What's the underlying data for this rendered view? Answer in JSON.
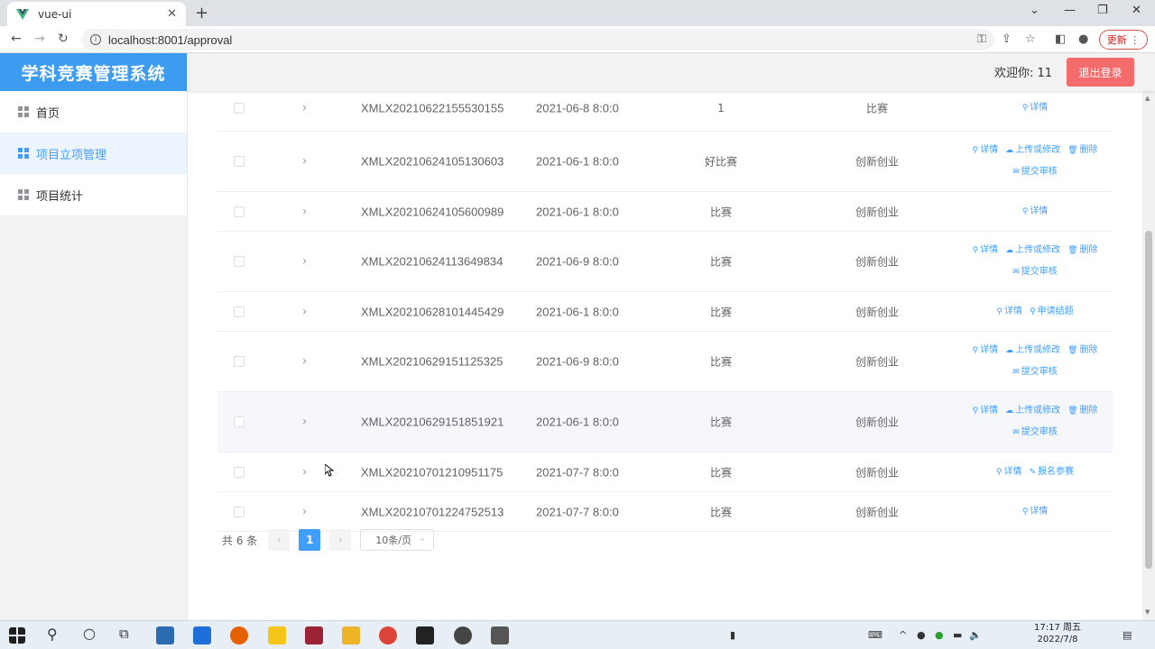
{
  "browser": {
    "tab_title": "vue-ui",
    "url": "localhost:8001/approval",
    "update_label": "更新"
  },
  "app": {
    "title": "学科竞赛管理系统",
    "welcome": "欢迎你: 11",
    "logout_label": "退出登录"
  },
  "sidebar": {
    "items": [
      {
        "label": "首页"
      },
      {
        "label": "项目立项管理"
      },
      {
        "label": "项目统计"
      }
    ]
  },
  "table": {
    "rows": [
      {
        "id": "XMLX20210622155530155",
        "date": "2021-06-8 8:0:0",
        "name": "1",
        "type": "比赛",
        "ops": [
          "详情"
        ]
      },
      {
        "id": "XMLX20210624105130603",
        "date": "2021-06-1 8:0:0",
        "name": "好比赛",
        "type": "创新创业",
        "ops": [
          "详情",
          "上传或修改",
          "删除",
          "提交审核"
        ]
      },
      {
        "id": "XMLX20210624105600989",
        "date": "2021-06-1 8:0:0",
        "name": "比赛",
        "type": "创新创业",
        "ops": [
          "详情"
        ]
      },
      {
        "id": "XMLX20210624113649834",
        "date": "2021-06-9 8:0:0",
        "name": "比赛",
        "type": "创新创业",
        "ops": [
          "详情",
          "上传或修改",
          "删除",
          "提交审核"
        ]
      },
      {
        "id": "XMLX20210628101445429",
        "date": "2021-06-1 8:0:0",
        "name": "比赛",
        "type": "创新创业",
        "ops": [
          "详情",
          "申请结题"
        ]
      },
      {
        "id": "XMLX20210629151125325",
        "date": "2021-06-9 8:0:0",
        "name": "比赛",
        "type": "创新创业",
        "ops": [
          "详情",
          "上传或修改",
          "删除",
          "提交审核"
        ]
      },
      {
        "id": "XMLX20210629151851921",
        "date": "2021-06-1 8:0:0",
        "name": "比赛",
        "type": "创新创业",
        "ops": [
          "详情",
          "上传或修改",
          "删除",
          "提交审核"
        ]
      },
      {
        "id": "XMLX20210701210951175",
        "date": "2021-07-7 8:0:0",
        "name": "比赛",
        "type": "创新创业",
        "ops": [
          "详情",
          "报名参赛"
        ]
      },
      {
        "id": "XMLX20210701224752513",
        "date": "2021-07-7 8:0:0",
        "name": "比赛",
        "type": "创新创业",
        "ops": [
          "详情"
        ]
      }
    ]
  },
  "pagination": {
    "total": "共 6 条",
    "current": "1",
    "page_size": "10条/页"
  },
  "taskbar": {
    "time": "17:17 周五",
    "date": "2022/7/8"
  },
  "colors": {
    "primary": "#409eff",
    "logo_bg": "#3d9cf0",
    "logout_bg": "#f56c6c"
  }
}
